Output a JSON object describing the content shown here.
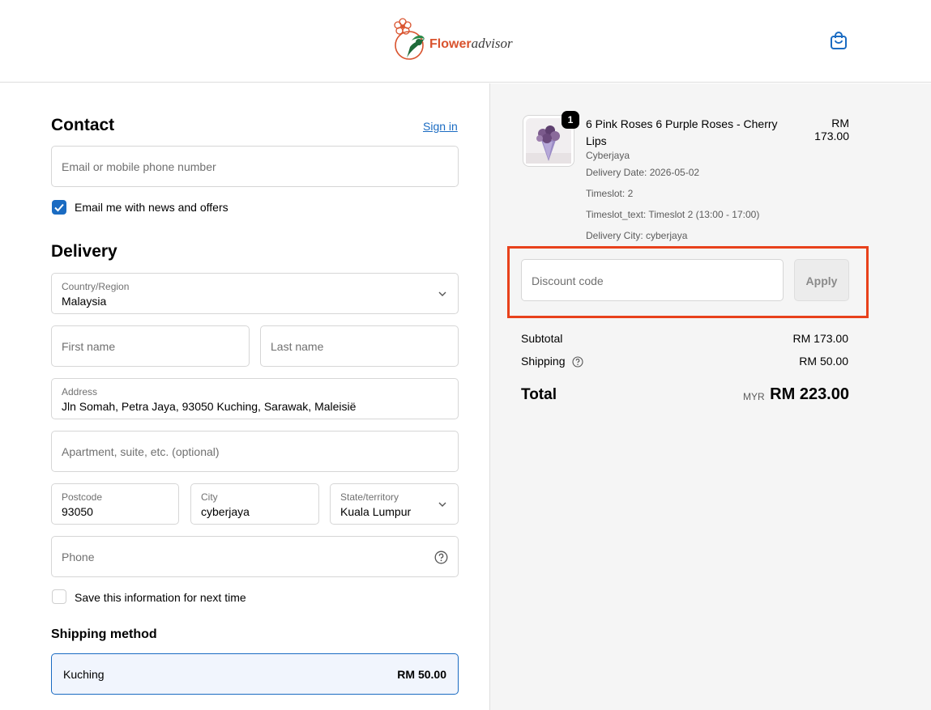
{
  "header": {
    "brand_primary": "Flower",
    "brand_secondary": "advisor"
  },
  "contact": {
    "title": "Contact",
    "sign_in": "Sign in",
    "email_placeholder": "Email or mobile phone number",
    "news_label": "Email me with news and offers",
    "news_checked": true
  },
  "delivery": {
    "title": "Delivery",
    "country_label": "Country/Region",
    "country_value": "Malaysia",
    "first_name_placeholder": "First name",
    "last_name_placeholder": "Last name",
    "address_label": "Address",
    "address_value": "Jln Somah, Petra Jaya, 93050 Kuching, Sarawak, Maleisië",
    "apartment_placeholder": "Apartment, suite, etc. (optional)",
    "postcode_label": "Postcode",
    "postcode_value": "93050",
    "city_label": "City",
    "city_value": "cyberjaya",
    "state_label": "State/territory",
    "state_value": "Kuala Lumpur",
    "phone_placeholder": "Phone",
    "save_label": "Save this information for next time",
    "save_checked": false
  },
  "shipping_method": {
    "title": "Shipping method",
    "name": "Kuching",
    "price": "RM 50.00"
  },
  "summary": {
    "item": {
      "quantity": "1",
      "title": "6 Pink Roses 6 Purple Roses - Cherry Lips",
      "price": "RM 173.00",
      "variant": "Cyberjaya",
      "delivery_date": "Delivery Date: 2026-05-02",
      "timeslot": "Timeslot: 2",
      "timeslot_text": "Timeslot_text: Timeslot 2 (13:00 - 17:00)",
      "delivery_city": "Delivery City: cyberjaya"
    },
    "discount_placeholder": "Discount code",
    "apply_label": "Apply",
    "subtotal_label": "Subtotal",
    "subtotal_value": "RM 173.00",
    "shipping_label": "Shipping",
    "shipping_value": "RM 50.00",
    "total_label": "Total",
    "currency": "MYR",
    "total_value": "RM 223.00"
  },
  "colors": {
    "accent": "#1a6bc2",
    "highlight": "#e8411b",
    "brand": "#d9532e"
  }
}
